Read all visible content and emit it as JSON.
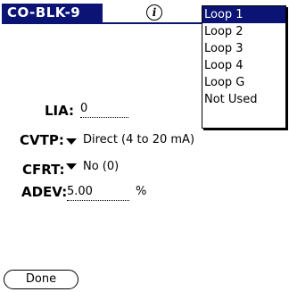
{
  "header": {
    "title": "CO-BLK-9",
    "info_icon": "info-icon"
  },
  "form": {
    "lia": {
      "label": "LIA:",
      "value": "0"
    },
    "cvtp": {
      "label": "CVTP:",
      "value": "Direct (4 to 20 mA)"
    },
    "cfrt": {
      "label": "CFRT:",
      "value": "No (0)"
    },
    "adev": {
      "label": "ADEV:",
      "value": "5.00",
      "unit": "%"
    }
  },
  "dropdown": {
    "items": [
      "Loop 1",
      "Loop 2",
      "Loop 3",
      "Loop 4",
      "Loop G",
      "Not Used"
    ],
    "selected": "Loop 1"
  },
  "footer": {
    "done_label": "Done"
  },
  "colors": {
    "accent": "#0b1475"
  }
}
